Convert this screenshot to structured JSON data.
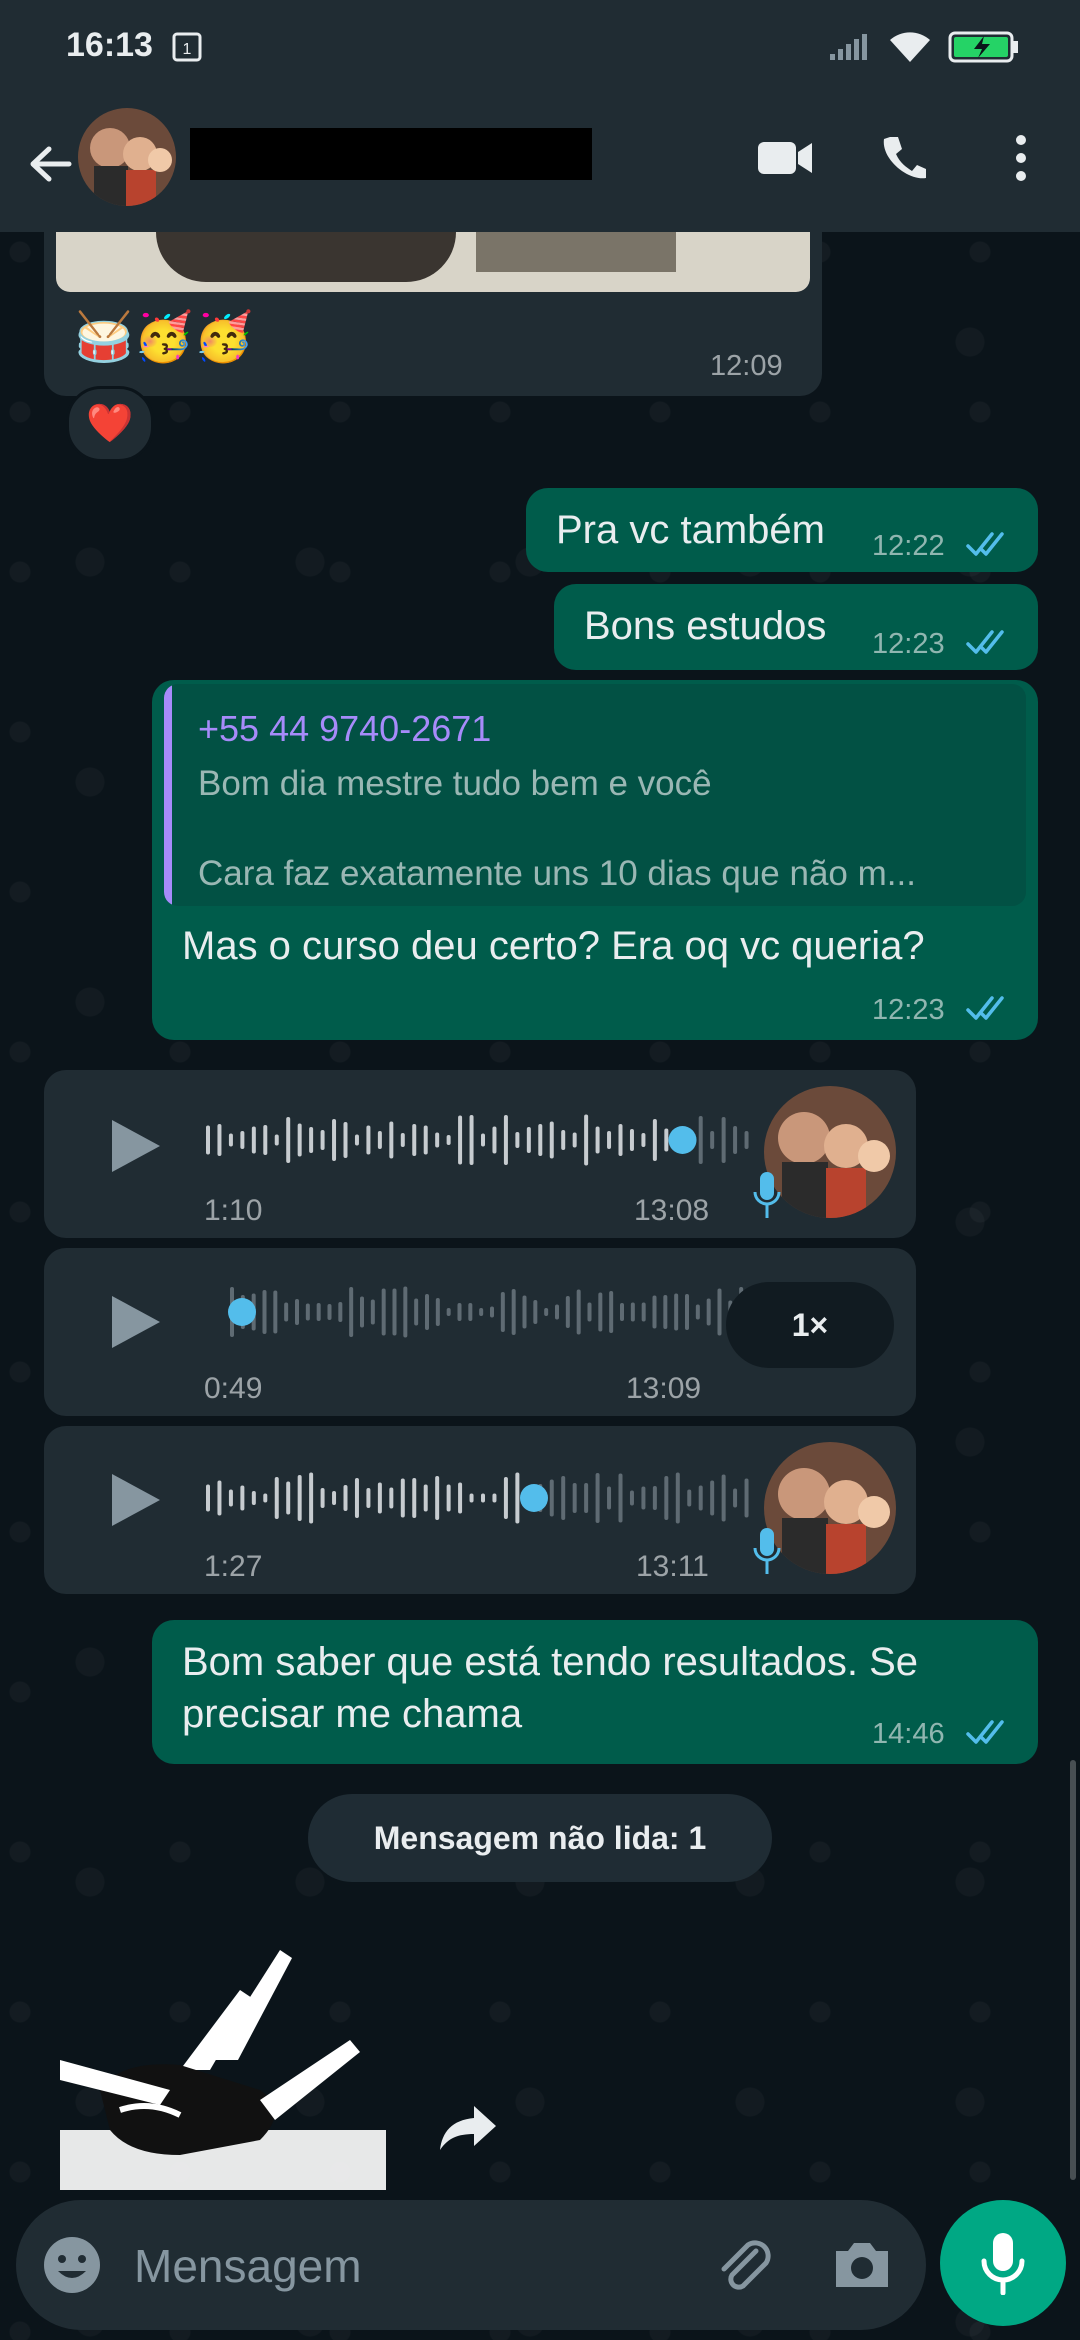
{
  "status_bar": {
    "time": "16:13",
    "notification_badge": "1"
  },
  "header": {
    "contact_name_redacted": true,
    "icons": [
      "back-arrow-icon",
      "video-call-icon",
      "voice-call-icon",
      "more-options-icon"
    ]
  },
  "colors": {
    "incoming": "#202c33",
    "outgoing": "#005c4b",
    "accent": "#00a884",
    "read_ticks": "#53bdeb",
    "quote_author": "#a78bfa"
  },
  "messages": {
    "image_msg": {
      "emoji_caption": "🥁🥳🥳",
      "time": "12:09",
      "reaction": "❤️"
    },
    "m1": {
      "text": "Pra vc também",
      "time": "12:22"
    },
    "m2": {
      "text": "Bons estudos",
      "time": "12:23"
    },
    "m3": {
      "quote_author": "+55 44 9740-2671",
      "quote_line1": "Bom dia mestre tudo bem e você",
      "quote_line2": "Cara faz exatamente uns 10 dias que não m...",
      "text": "Mas o curso deu certo? Era oq vc queria?",
      "time": "12:23"
    },
    "voice1": {
      "duration": "1:10",
      "time": "13:08",
      "progress": 0.87
    },
    "voice2": {
      "duration": "0:49",
      "time": "13:09",
      "progress": 0.0,
      "speed": "1×"
    },
    "voice3": {
      "duration": "1:27",
      "time": "13:11",
      "progress": 0.6
    },
    "m4": {
      "line1": "Bom saber que está tendo resultados. Se",
      "line2": "precisar me chama",
      "time": "14:46"
    }
  },
  "unread_banner": "Mensagem não lida: 1",
  "composer": {
    "placeholder": "Mensagem"
  }
}
